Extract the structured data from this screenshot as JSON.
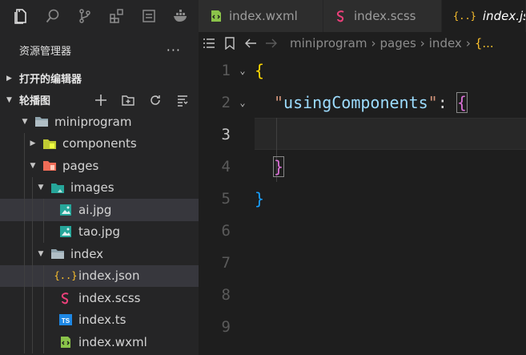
{
  "activity": {
    "icons": [
      "explorer-icon",
      "search-icon",
      "source-control-icon",
      "extensions-icon",
      "debug-icon",
      "docker-icon"
    ]
  },
  "sidebar": {
    "title": "资源管理器",
    "more": "···",
    "open_editors": "打开的编辑器",
    "project": "轮播图",
    "tree": [
      {
        "label": "miniprogram",
        "depth": 1,
        "type": "folder-open",
        "expanded": true
      },
      {
        "label": "components",
        "depth": 2,
        "type": "folder-components",
        "expanded": false
      },
      {
        "label": "pages",
        "depth": 2,
        "type": "folder-pages",
        "expanded": true
      },
      {
        "label": "images",
        "depth": 3,
        "type": "folder-images",
        "expanded": true
      },
      {
        "label": "ai.jpg",
        "depth": 4,
        "type": "image",
        "selected": true
      },
      {
        "label": "tao.jpg",
        "depth": 4,
        "type": "image"
      },
      {
        "label": "index",
        "depth": 3,
        "type": "folder-open",
        "expanded": true
      },
      {
        "label": "index.json",
        "depth": 4,
        "type": "json",
        "selected": true
      },
      {
        "label": "index.scss",
        "depth": 4,
        "type": "scss"
      },
      {
        "label": "index.ts",
        "depth": 4,
        "type": "ts"
      },
      {
        "label": "index.wxml",
        "depth": 4,
        "type": "wxml"
      }
    ]
  },
  "tabs": [
    {
      "label": "index.wxml",
      "icon": "wxml-icon",
      "active": false
    },
    {
      "label": "index.scss",
      "icon": "scss-icon",
      "active": false
    },
    {
      "label": "index.json",
      "icon": "json-icon",
      "active": true
    }
  ],
  "breadcrumb": {
    "parts": [
      "miniprogram",
      "pages",
      "index",
      "{..."
    ]
  },
  "editor": {
    "line_numbers": [
      "1",
      "2",
      "3",
      "4",
      "5",
      "6",
      "7",
      "8",
      "9"
    ],
    "current_line": 3,
    "code": {
      "l1_open": "{",
      "l2_quote_open": "\"",
      "l2_key": "usingComponents",
      "l2_quote_close": "\"",
      "l2_colon": ": ",
      "l2_brace": "{",
      "l4_brace": "}",
      "l5_brace": "}"
    }
  },
  "colors": {
    "bg": "#1e1e1e",
    "sidebar": "#252526",
    "selection": "#37373d",
    "brace_yellow": "#ffd700",
    "brace_purple": "#da70d6",
    "brace_blue": "#179fff",
    "json_key": "#9cdcfe"
  }
}
